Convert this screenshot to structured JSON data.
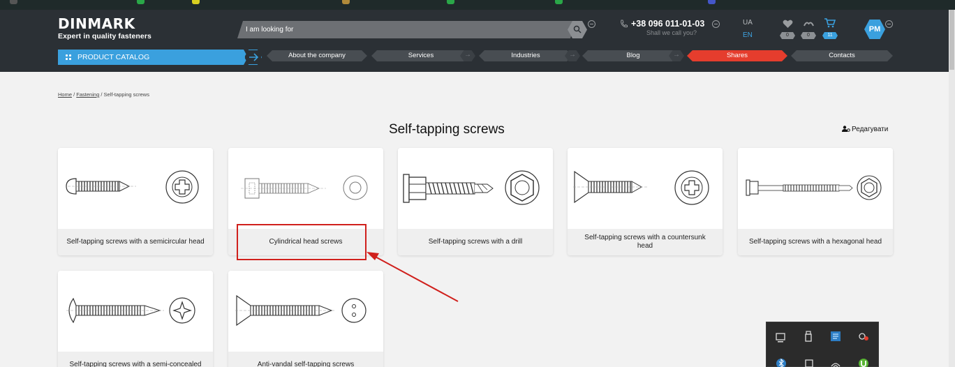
{
  "header": {
    "logo_word": "DINMARK",
    "logo_tagline": "Expert in quality fasteners",
    "search_placeholder": "I am looking for",
    "phone": "+38 096 011-01-03",
    "phone_sub": "Shall we call you?",
    "lang_ua": "UA",
    "lang_en": "EN",
    "favorites_count": "0",
    "compare_count": "0",
    "cart_count": "11",
    "avatar": "PM"
  },
  "nav": {
    "catalog": "PRODUCT CATALOG",
    "items": [
      "About the company",
      "Services",
      "Industries",
      "Blog",
      "Shares",
      "Contacts"
    ]
  },
  "breadcrumb": {
    "home": "Home",
    "sep": "/",
    "fastening": "Fastening",
    "current": "Self-tapping screws"
  },
  "page": {
    "title": "Self-tapping screws",
    "edit": "Редагувати"
  },
  "cards": [
    {
      "label": "Self-tapping screws with a semicircular head",
      "icon": "semicircular-head-screw"
    },
    {
      "label": "Cylindrical head screws",
      "icon": "cylindrical-head-screw"
    },
    {
      "label": "Self-tapping screws with a drill",
      "icon": "drill-point-screw"
    },
    {
      "label": "Self-tapping screws with a countersunk head",
      "icon": "countersunk-head-screw"
    },
    {
      "label": "Self-tapping screws with a hexagonal head",
      "icon": "hex-head-screw"
    },
    {
      "label": "Self-tapping screws with a semi-concealed",
      "icon": "semi-concealed-head-screw"
    },
    {
      "label": "Anti-vandal self-tapping screws",
      "icon": "anti-vandal-screw"
    }
  ],
  "colors": {
    "header_bg": "#2b3035",
    "accent_blue": "#3aa0de",
    "shares_red": "#e53d2d",
    "annotation_red": "#d0201c"
  }
}
